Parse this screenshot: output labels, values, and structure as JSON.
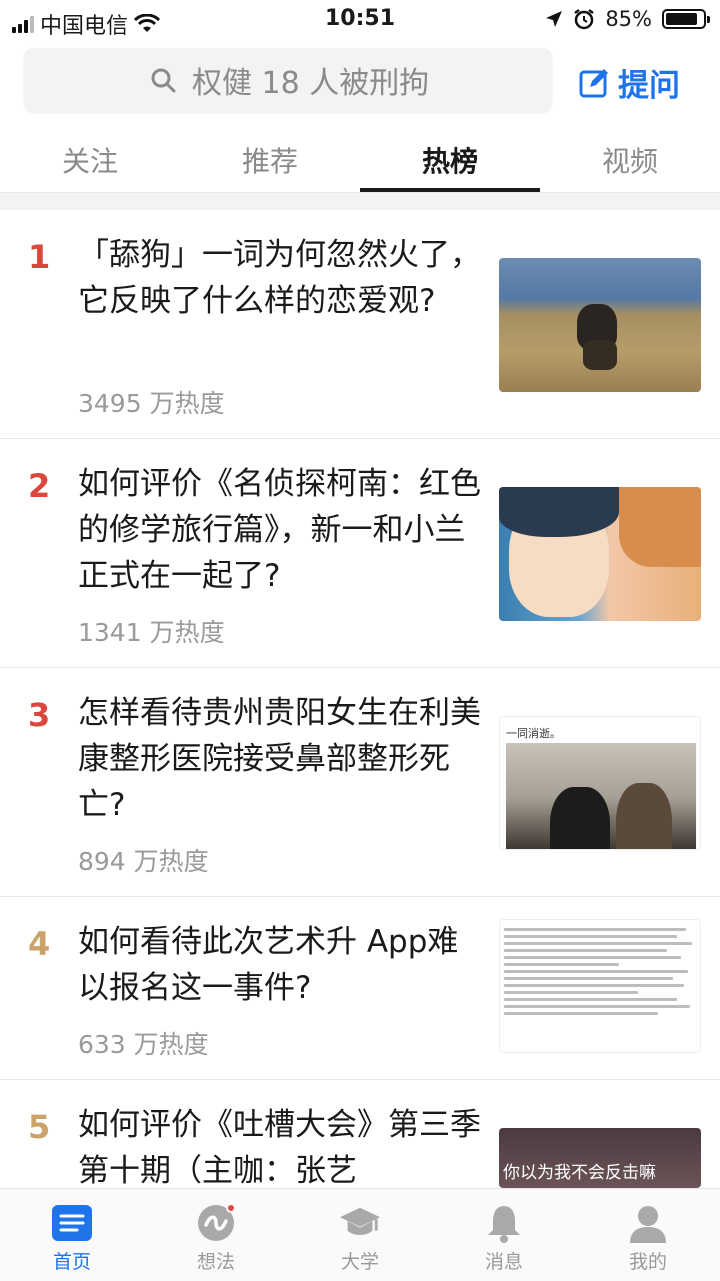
{
  "status_bar": {
    "carrier": "中国电信",
    "time": "10:51",
    "battery_text": "85%",
    "battery_level": 0.85
  },
  "search": {
    "placeholder": "权健 18 人被刑拘"
  },
  "header": {
    "ask_label": "提问"
  },
  "tabs": [
    {
      "label": "关注",
      "active": false
    },
    {
      "label": "推荐",
      "active": false
    },
    {
      "label": "热榜",
      "active": true
    },
    {
      "label": "视频",
      "active": false
    }
  ],
  "hot_list": [
    {
      "rank": "1",
      "rank_color": "#d9483b",
      "title": "「舔狗」一词为何忽然火了，它反映了什么样的恋爱观?",
      "heat": "3495 万热度"
    },
    {
      "rank": "2",
      "rank_color": "#d9483b",
      "title": "如何评价《名侦探柯南：红色的修学旅行篇》，新一和小兰正式在一起了?",
      "heat": "1341 万热度"
    },
    {
      "rank": "3",
      "rank_color": "#d9483b",
      "title": "怎样看待贵州贵阳女生在利美康整形医院接受鼻部整形死亡?",
      "heat": "894 万热度",
      "thumb_caption": "一同消逝。"
    },
    {
      "rank": "4",
      "rank_color": "#c9a36a",
      "title": "如何看待此次艺术升 App难以报名这一事件?",
      "heat": "633 万热度"
    },
    {
      "rank": "5",
      "rank_color": "#c9a36a",
      "title": "如何评价《吐槽大会》第三季第十期（主咖：张艺",
      "heat": "",
      "thumb_caption": "你以为我不会反击嘛"
    }
  ],
  "bottom_nav": [
    {
      "label": "首页",
      "icon": "home-icon",
      "active": true
    },
    {
      "label": "想法",
      "icon": "ideas-icon",
      "active": false
    },
    {
      "label": "大学",
      "icon": "graduation-cap-icon",
      "active": false
    },
    {
      "label": "消息",
      "icon": "bell-icon",
      "active": false
    },
    {
      "label": "我的",
      "icon": "profile-icon",
      "active": false
    }
  ],
  "colors": {
    "accent": "#1e74e8",
    "rank_top": "#d9483b",
    "rank_other": "#c9a36a"
  }
}
